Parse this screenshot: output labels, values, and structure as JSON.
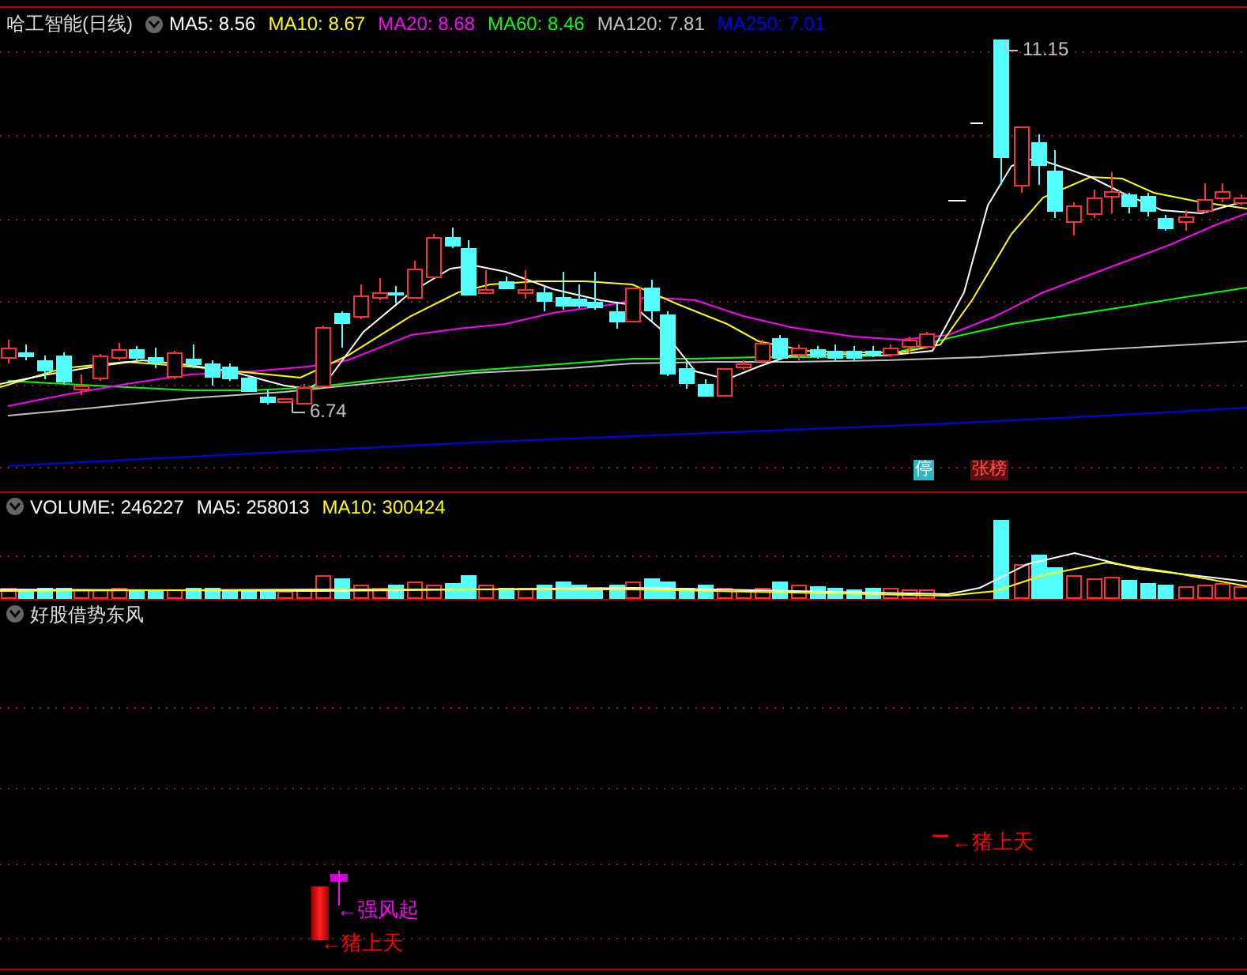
{
  "chart_header": {
    "title": "哈工智能(日线)",
    "indicators": [
      {
        "label": "MA5: 8.56",
        "color": "#ffffff"
      },
      {
        "label": "MA10: 8.67",
        "color": "#ffff00"
      },
      {
        "label": "MA20: 8.68",
        "color": "#ff00ff"
      },
      {
        "label": "MA60: 8.46",
        "color": "#00ff00"
      },
      {
        "label": "MA120: 7.81",
        "color": "#c0c0c0"
      },
      {
        "label": "MA250: 7.01",
        "color": "#0000ff"
      }
    ]
  },
  "price_chart": {
    "annotations": [
      {
        "text": "11.15"
      },
      {
        "text": "6.74"
      }
    ],
    "markers": [
      {
        "text": "停",
        "kind": "limit"
      },
      {
        "text": "张榜",
        "kind": "board"
      }
    ]
  },
  "volume_panel": {
    "indicators": [
      {
        "label": "VOLUME: 246227",
        "color": "#ffffff"
      },
      {
        "label": "MA5: 258013",
        "color": "#ffffff"
      },
      {
        "label": "MA10: 300424",
        "color": "#ffff00"
      }
    ]
  },
  "signal_panel": {
    "title": "好股借势东风",
    "signals": [
      {
        "text": "←猪上天",
        "color": "#ff0000"
      },
      {
        "text": "←强风起",
        "color": "#ff00ff"
      },
      {
        "text": "←猪上天",
        "color": "#ff0000"
      }
    ]
  }
}
